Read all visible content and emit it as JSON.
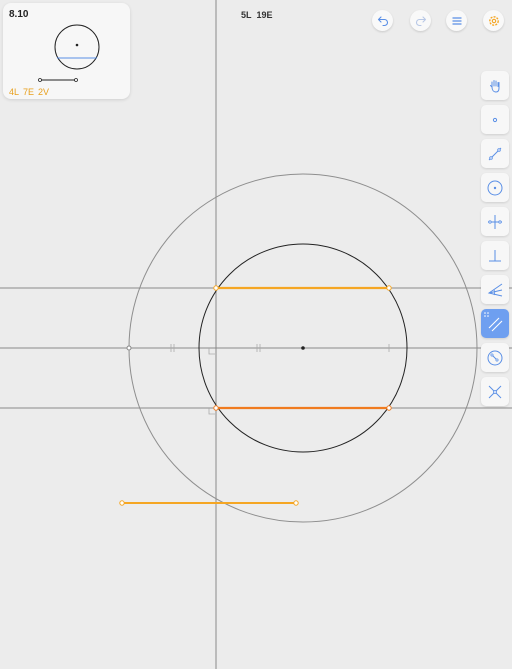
{
  "level": {
    "number": "8.10",
    "stats": {
      "L": "4L",
      "E": "7E",
      "V": "2V"
    }
  },
  "score": {
    "L": "5L",
    "E": "19E"
  },
  "colors": {
    "background": "#ececec",
    "accent": "#f5a623",
    "accent_dark": "#f07b1f",
    "active_tool": "#6e9ff0",
    "icon": "#5a8fe6",
    "line": "#8a8a8a"
  },
  "top_buttons": [
    {
      "name": "undo-icon"
    },
    {
      "name": "redo-icon"
    },
    {
      "name": "menu-icon"
    },
    {
      "name": "settings-icon"
    }
  ],
  "tools": [
    {
      "name": "hand-tool-icon",
      "active": false
    },
    {
      "name": "point-tool-icon",
      "active": false
    },
    {
      "name": "line-tool-icon",
      "active": false
    },
    {
      "name": "circle-tool-icon",
      "active": false
    },
    {
      "name": "perpendicular-bisector-tool-icon",
      "active": false
    },
    {
      "name": "perpendicular-tool-icon",
      "active": false
    },
    {
      "name": "angle-bisector-tool-icon",
      "active": false
    },
    {
      "name": "parallel-tool-icon",
      "active": true
    },
    {
      "name": "compass-tool-icon",
      "active": false
    },
    {
      "name": "intersect-tool-icon",
      "active": false
    }
  ]
}
